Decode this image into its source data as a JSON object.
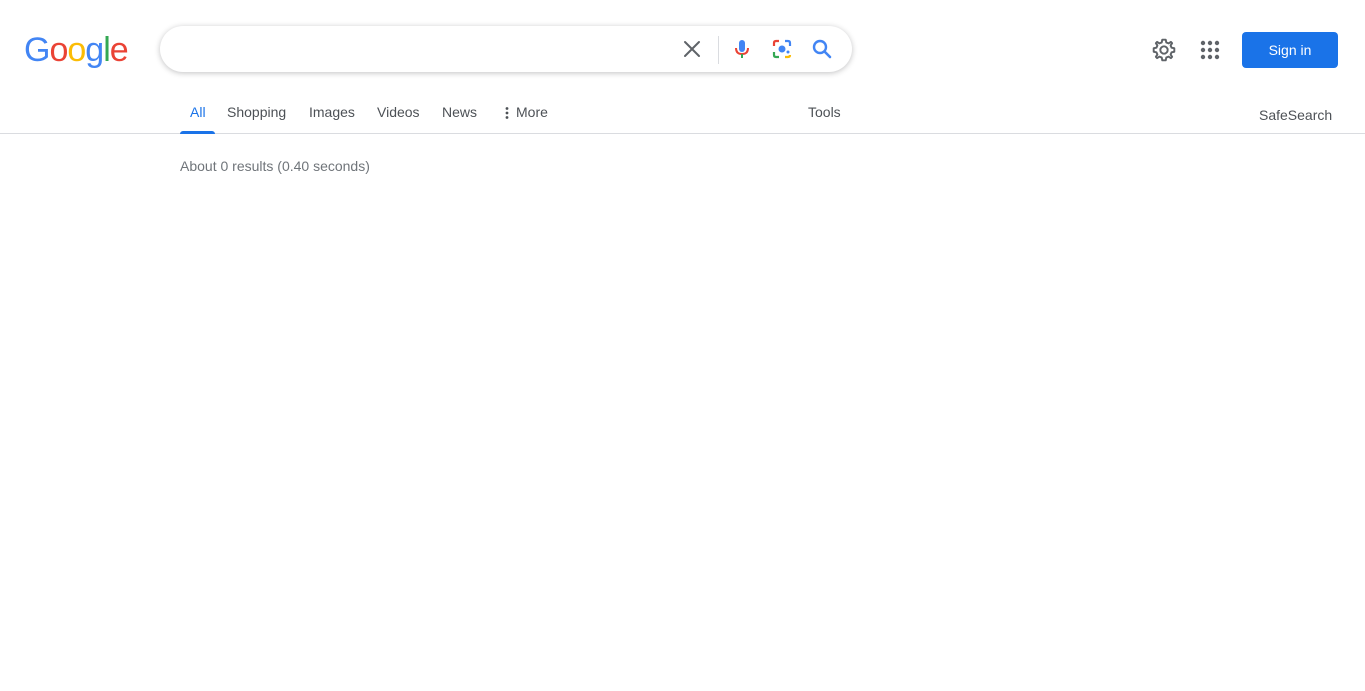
{
  "logo": {
    "letters": [
      "G",
      "o",
      "o",
      "g",
      "l",
      "e"
    ],
    "colors": [
      "#4285f4",
      "#ea4335",
      "#fbbc05",
      "#4285f4",
      "#34a853",
      "#ea4335"
    ]
  },
  "search": {
    "value": "",
    "placeholder": ""
  },
  "icons": {
    "clear": "close-icon",
    "voice": "microphone-icon",
    "lens": "camera-lens-icon",
    "search": "search-icon",
    "settings": "gear-icon",
    "apps": "apps-grid-icon"
  },
  "header": {
    "signin_label": "Sign in"
  },
  "tabs": [
    {
      "label": "All",
      "active": true
    },
    {
      "label": "Shopping"
    },
    {
      "label": "Images"
    },
    {
      "label": "Videos"
    },
    {
      "label": "News"
    },
    {
      "label": "More"
    }
  ],
  "tools_label": "Tools",
  "safesearch_label": "SafeSearch",
  "result_stats": "About 0 results (0.40 seconds)",
  "colors": {
    "accent": "#1a73e8",
    "text_secondary": "#4d5156",
    "stats": "#70757a"
  }
}
